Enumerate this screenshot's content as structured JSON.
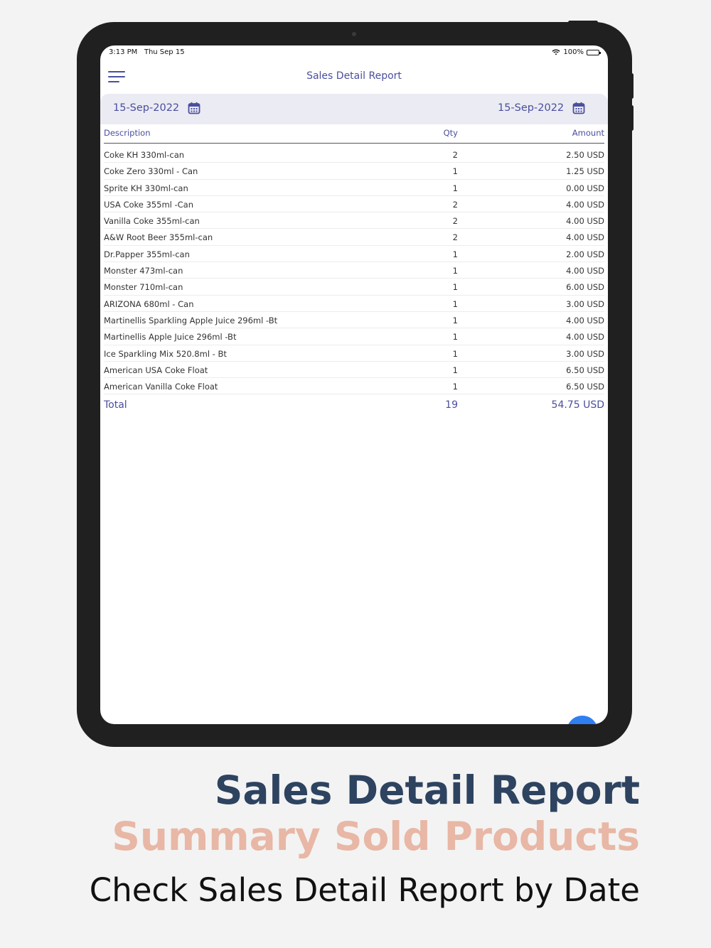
{
  "status_bar": {
    "time": "3:13 PM",
    "date": "Thu Sep 15",
    "battery": "100%"
  },
  "nav": {
    "title": "Sales Detail Report",
    "menu_icon": "hamburger-menu-icon"
  },
  "date_range": {
    "start": "15-Sep-2022",
    "end": "15-Sep-2022",
    "icon": "calendar-icon"
  },
  "table": {
    "columns": [
      "Description",
      "Qty",
      "Amount"
    ],
    "rows": [
      {
        "description": "Coke KH 330ml-can",
        "qty": "2",
        "amount": "2.50 USD"
      },
      {
        "description": "Coke Zero 330ml - Can",
        "qty": "1",
        "amount": "1.25 USD"
      },
      {
        "description": "Sprite KH 330ml-can",
        "qty": "1",
        "amount": "0.00 USD"
      },
      {
        "description": "USA Coke 355ml -Can",
        "qty": "2",
        "amount": "4.00 USD"
      },
      {
        "description": "Vanilla Coke 355ml-can",
        "qty": "2",
        "amount": "4.00 USD"
      },
      {
        "description": "A&W Root Beer 355ml-can",
        "qty": "2",
        "amount": "4.00 USD"
      },
      {
        "description": "Dr.Papper 355ml-can",
        "qty": "1",
        "amount": "2.00 USD"
      },
      {
        "description": "Monster 473ml-can",
        "qty": "1",
        "amount": "4.00 USD"
      },
      {
        "description": "Monster 710ml-can",
        "qty": "1",
        "amount": "6.00 USD"
      },
      {
        "description": "ARIZONA 680ml - Can",
        "qty": "1",
        "amount": "3.00 USD"
      },
      {
        "description": "Martinellis Sparkling Apple Juice 296ml -Bt",
        "qty": "1",
        "amount": "4.00 USD"
      },
      {
        "description": "Martinellis Apple Juice 296ml -Bt",
        "qty": "1",
        "amount": "4.00 USD"
      },
      {
        "description": "Ice Sparkling Mix 520.8ml - Bt",
        "qty": "1",
        "amount": "3.00 USD"
      },
      {
        "description": "American USA Coke Float",
        "qty": "1",
        "amount": "6.50 USD"
      },
      {
        "description": "American Vanilla Coke Float",
        "qty": "1",
        "amount": "6.50 USD"
      }
    ],
    "total": {
      "label": "Total",
      "qty": "19",
      "amount": "54.75 USD"
    }
  },
  "caption": {
    "title": "Sales Detail Report",
    "subtitle": "Summary Sold Products",
    "description": "Check Sales Detail Report by Date"
  },
  "colors": {
    "accent": "#4a4f9e",
    "caption_title": "#2d4360",
    "caption_subtitle": "#e8b7a5",
    "fab": "#2e7ff0"
  }
}
